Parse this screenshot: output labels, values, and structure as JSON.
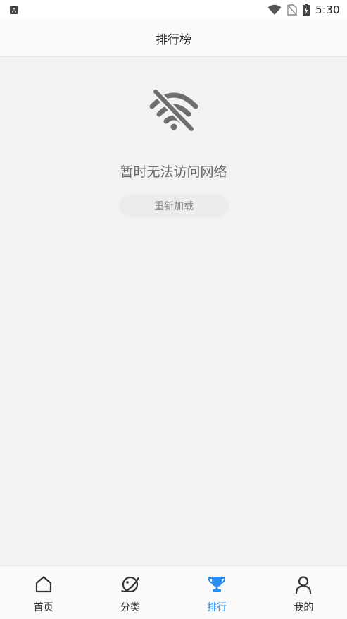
{
  "status_bar": {
    "time": "5:30",
    "notification_glyph": "A",
    "icons": [
      "wifi-icon",
      "no-sim-icon",
      "battery-charging-icon"
    ]
  },
  "header": {
    "title": "排行榜"
  },
  "empty_state": {
    "icon": "no-wifi-icon",
    "message": "暂时无法访问网络",
    "reload_label": "重新加载"
  },
  "bottom_nav": {
    "accent_color": "#2a8ff0",
    "items": [
      {
        "label": "首页",
        "icon": "home-icon",
        "active": false
      },
      {
        "label": "分类",
        "icon": "planet-icon",
        "active": false
      },
      {
        "label": "排行",
        "icon": "trophy-icon",
        "active": true
      },
      {
        "label": "我的",
        "icon": "user-icon",
        "active": false
      }
    ]
  }
}
